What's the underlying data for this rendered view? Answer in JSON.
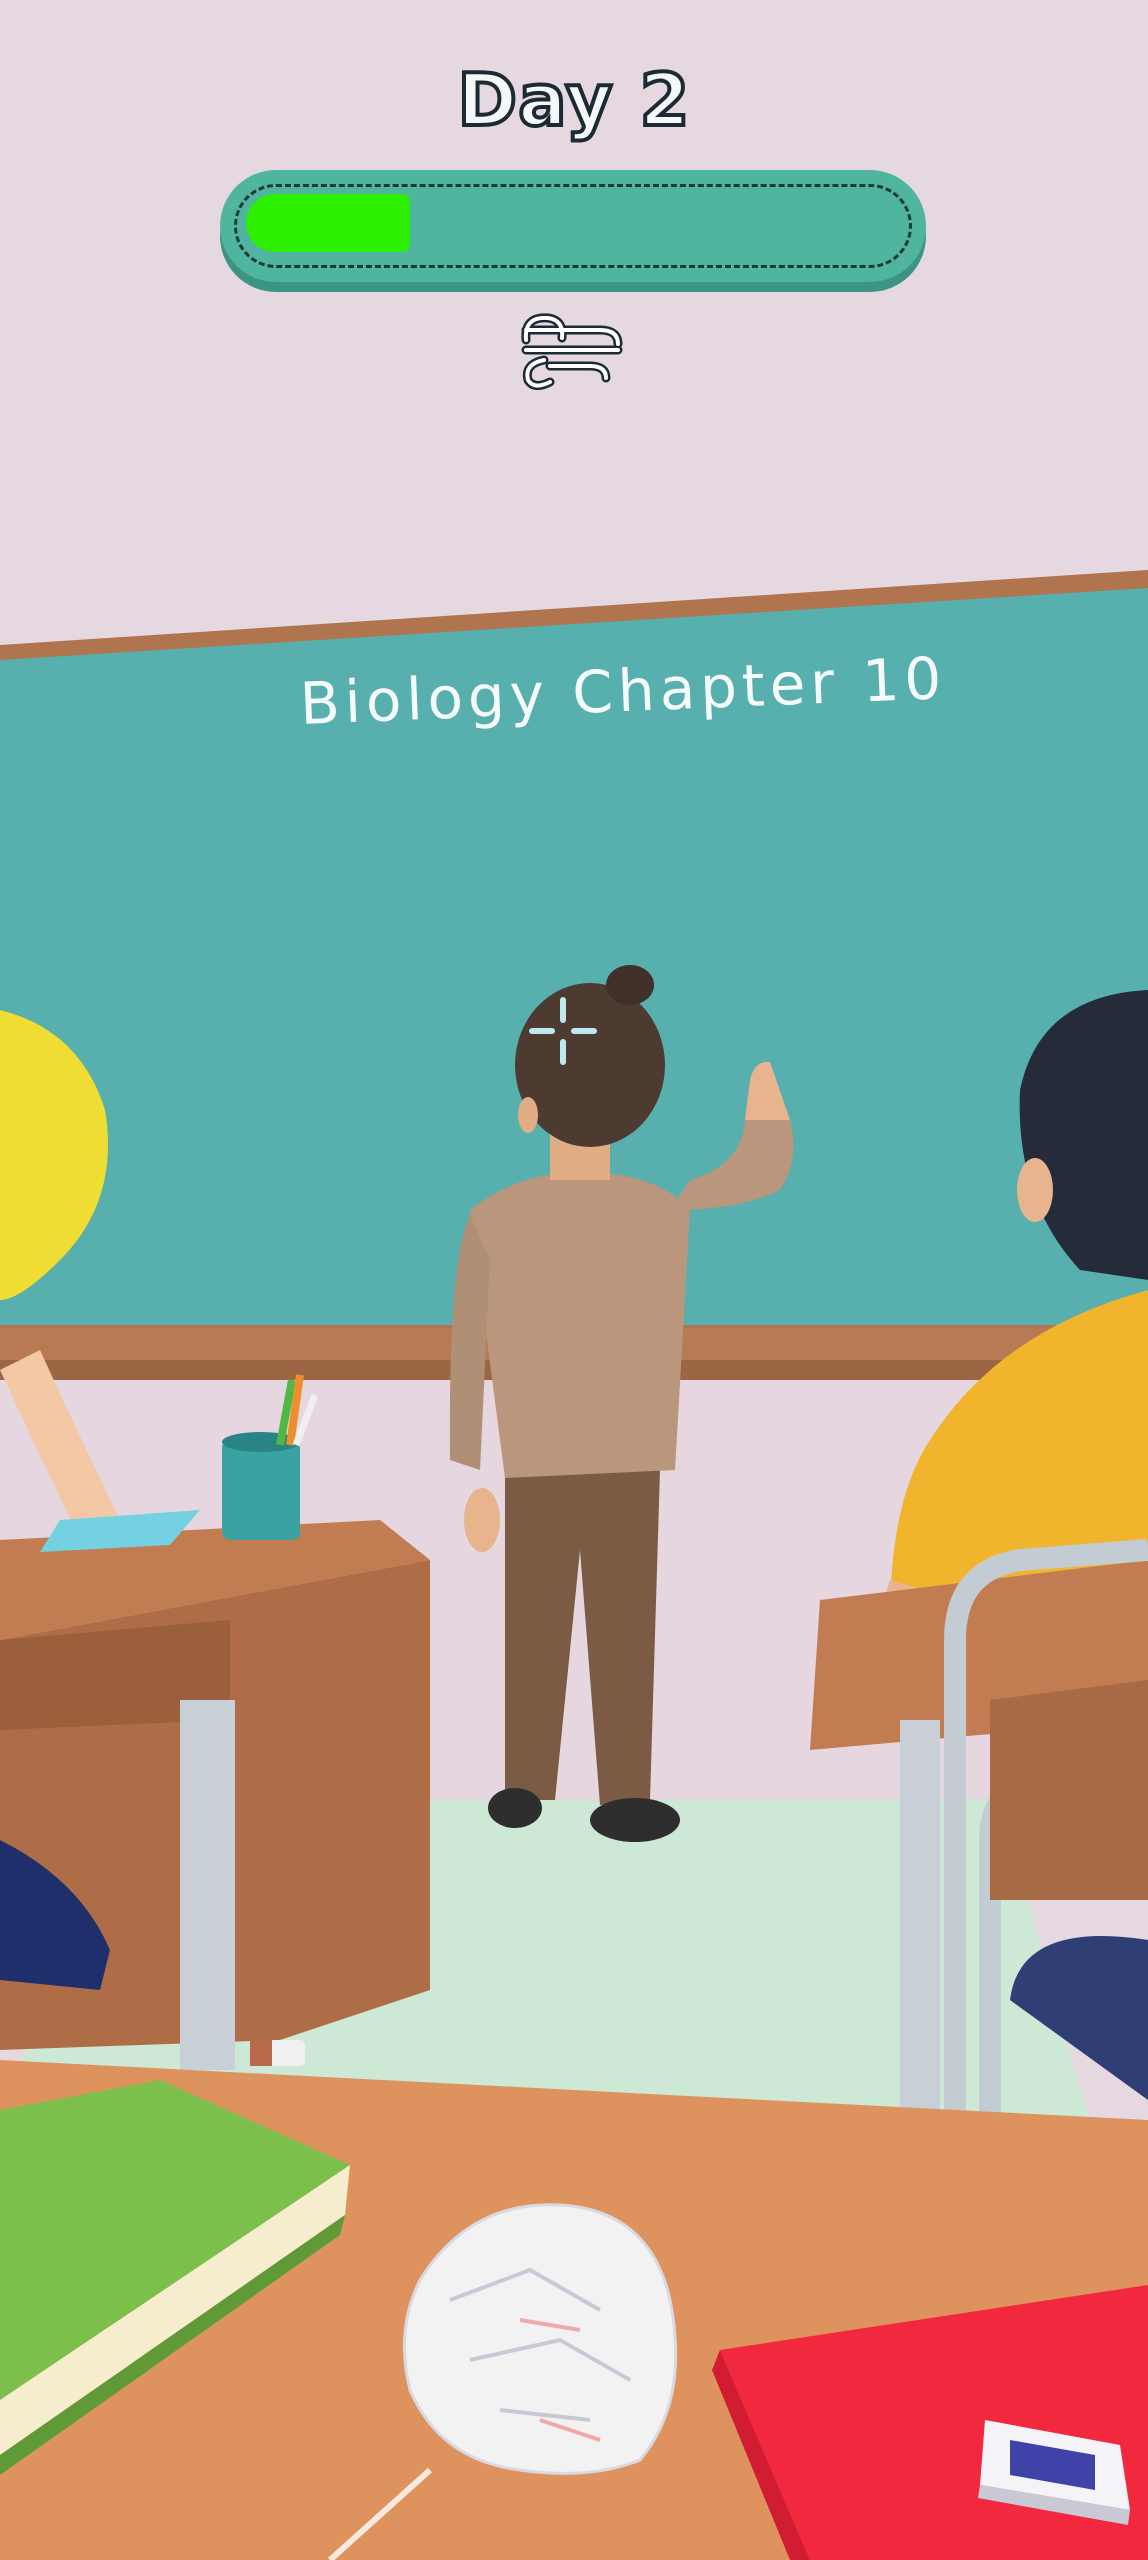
{
  "hud": {
    "day_label": "Day 2",
    "progress_percent": 0.25,
    "progress_color": "#2df000",
    "bar_color": "#4fb59e",
    "ability_icon": "wind-icon"
  },
  "classroom": {
    "chalkboard_text": "Biology Chapter 10",
    "chalkboard_color": "#57b0ae",
    "wall_color": "#e6d8e0",
    "crosshair_icon": "crosshair-icon"
  },
  "desk_items": {
    "book_left_color": "#7cbf4a",
    "book_right_color": "#f2283e",
    "paper_ball": "crumpled-paper-ball",
    "eraser": "eraser"
  }
}
